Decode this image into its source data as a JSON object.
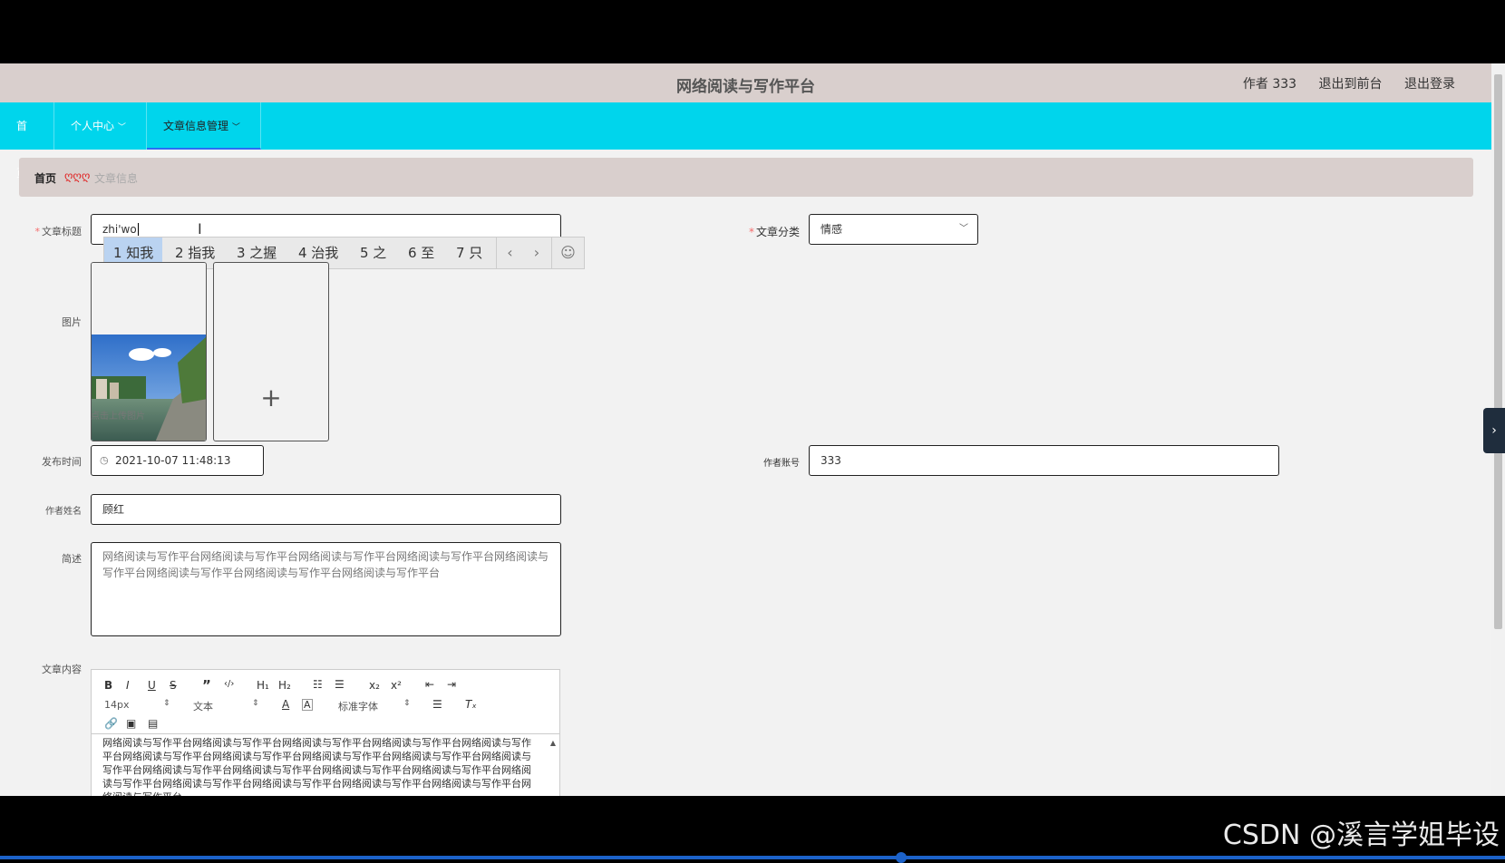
{
  "header": {
    "title": "网络阅读与写作平台",
    "user": "作者 333",
    "frontend": "退出到前台",
    "logout": "退出登录"
  },
  "nav": {
    "home": "首页",
    "personal": "个人中心",
    "article_mgmt": "文章信息管理"
  },
  "breadcrumb": {
    "home": "首页",
    "sep": "ღღღ",
    "current": "文章信息"
  },
  "form": {
    "title_label": "文章标题",
    "title_value": "zhi'wo",
    "category_label": "文章分类",
    "category_value": "情感",
    "image_label": "图片",
    "upload_hint": "点击上传图片",
    "publish_label": "发布时间",
    "publish_value": "2021-10-07 11:48:13",
    "account_label": "作者账号",
    "account_value": "333",
    "author_label": "作者姓名",
    "author_value": "顾红",
    "summary_label": "简述",
    "summary_value": "网络阅读与写作平台网络阅读与写作平台网络阅读与写作平台网络阅读与写作平台网络阅读与写作平台网络阅读与写作平台网络阅读与写作平台网络阅读与写作平台",
    "content_label": "文章内容",
    "content_value": "网络阅读与写作平台网络阅读与写作平台网络阅读与写作平台网络阅读与写作平台网络阅读与写作平台网络阅读与写作平台网络阅读与写作平台网络阅读与写作平台网络阅读与写作平台网络阅读与写作平台网络阅读与写作平台网络阅读与写作平台网络阅读与写作平台网络阅读与写作平台网络阅读与写作平台网络阅读与写作平台网络阅读与写作平台网络阅读与写作平台网络阅读与写作平台网络阅读与写作平台"
  },
  "ime": {
    "candidates": [
      "1 知我",
      "2 指我",
      "3 之握",
      "4 治我",
      "5 之",
      "6 至",
      "7 只"
    ]
  },
  "editor": {
    "font_size": "14px",
    "text_type": "文本",
    "font_family": "标准字体"
  },
  "watermark": "CSDN @溪言学姐毕设",
  "colors": {
    "nav": "#00d5ec",
    "header": "#d9cfcd",
    "required": "#f56c6c"
  }
}
